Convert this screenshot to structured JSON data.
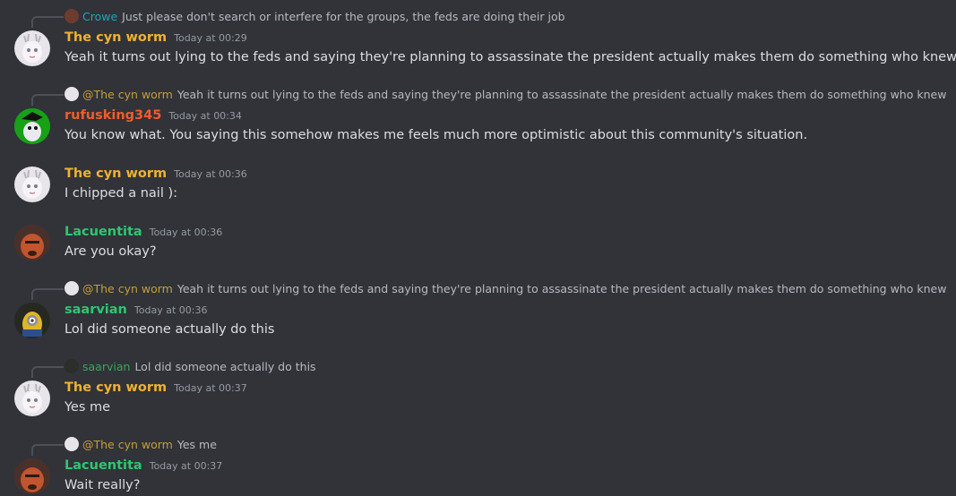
{
  "colors": {
    "cyn": "#f0b132",
    "ruf": "#f25c2b",
    "green": "#2dc770",
    "crowe": "#1ba6bf",
    "mention_cyn": "#c49e38",
    "mention_saar": "#3ba55d"
  },
  "messages": [
    {
      "reply": {
        "author": "Crowe",
        "text": "Just please don't search or interfere for the groups, the feds are doing their job"
      },
      "author": "The cyn worm",
      "time": "Today at 00:29",
      "text": "Yeah it turns out lying to the feds and saying they're planning to assassinate the president actually makes them do something who knew"
    },
    {
      "reply": {
        "author": "@The cyn worm",
        "text": "Yeah it turns out lying to the feds and saying they're planning to assassinate the president actually makes them do something who knew"
      },
      "author": "rufusking345",
      "time": "Today at 00:34",
      "text": "You know what. You saying this somehow makes me feels much more optimistic about this community's situation."
    },
    {
      "author": "The cyn worm",
      "time": "Today at 00:36",
      "text": "I chipped a nail ):"
    },
    {
      "author": "Lacuentita",
      "time": "Today at 00:36",
      "text": "Are you okay?"
    },
    {
      "reply": {
        "author": "@The cyn worm",
        "text": "Yeah it turns out lying to the feds and saying they're planning to assassinate the president actually makes them do something who knew"
      },
      "author": "saarvian",
      "time": "Today at 00:36",
      "text": "Lol did someone actually do this"
    },
    {
      "reply": {
        "author": "saarvian",
        "text": "Lol did someone actually do this"
      },
      "author": "The cyn worm",
      "time": "Today at 00:37",
      "text": "Yes me"
    },
    {
      "reply": {
        "author": "@The cyn worm",
        "text": "Yes me"
      },
      "author": "Lacuentita",
      "time": "Today at 00:37",
      "text": "Wait really?"
    }
  ]
}
